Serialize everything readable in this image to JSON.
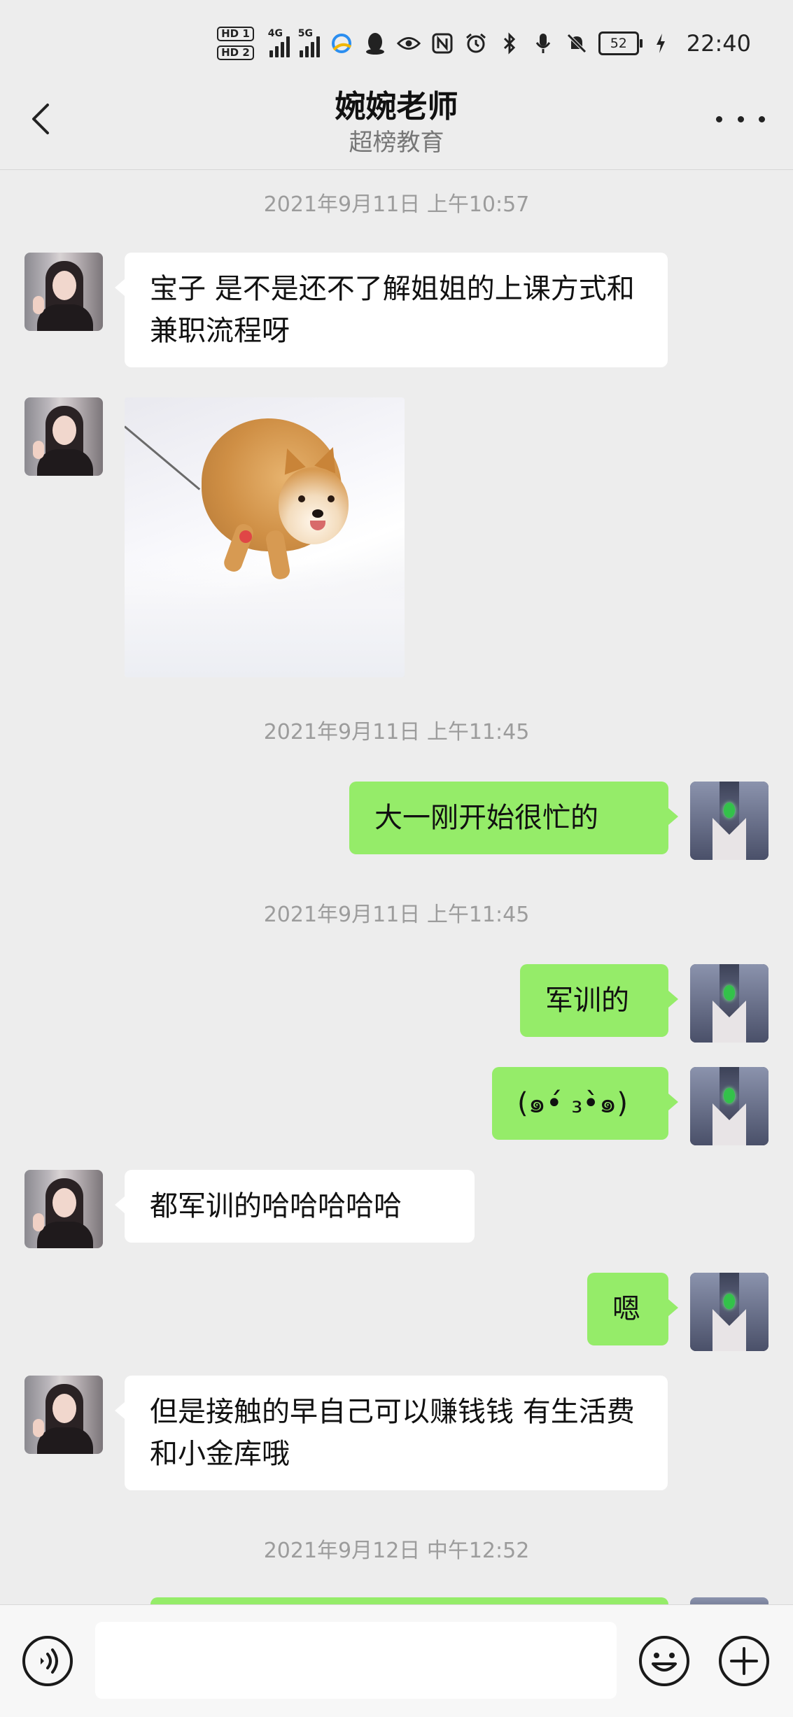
{
  "status_bar": {
    "hd1": "HD 1",
    "hd2": "HD 2",
    "net1": "4G",
    "net2": "5G",
    "battery": "52",
    "time": "22:40",
    "icons": [
      "qq-browser-icon",
      "qq-icon",
      "eye-icon",
      "nfc-icon",
      "alarm-icon",
      "bluetooth-icon",
      "mic-icon",
      "mute-icon",
      "charging-icon"
    ]
  },
  "header": {
    "title": "婉婉老师",
    "subtitle": "超榜教育",
    "back_icon": "chevron-left-icon",
    "more_icon": "more-dots-icon"
  },
  "timestamps": {
    "t1": "2021年9月11日 上午10:57",
    "t2": "2021年9月11日 上午11:45",
    "t3": "2021年9月11日 上午11:45",
    "t4": "2021年9月12日 中午12:52"
  },
  "messages": {
    "m1": "宝子  是不是还不了解姐姐的上课方式和兼职流程呀",
    "m2_image": "shiba-inu-in-snow",
    "m3": "大一刚开始很忙的",
    "m4": "军训的",
    "m5": "(๑•́ ₃•̀๑)",
    "m6": "都军训的哈哈哈哈哈",
    "m7": "嗯",
    "m8": "但是接触的早自己可以赚钱钱 有生活费 和小金库哦"
  },
  "input_bar": {
    "placeholder": "",
    "voice_icon": "voice-icon",
    "emoji_icon": "emoji-icon",
    "plus_icon": "plus-icon"
  },
  "colors": {
    "background": "#ededed",
    "incoming_bubble": "#ffffff",
    "outgoing_bubble": "#95ec69",
    "timestamp": "#9c9c9c"
  }
}
